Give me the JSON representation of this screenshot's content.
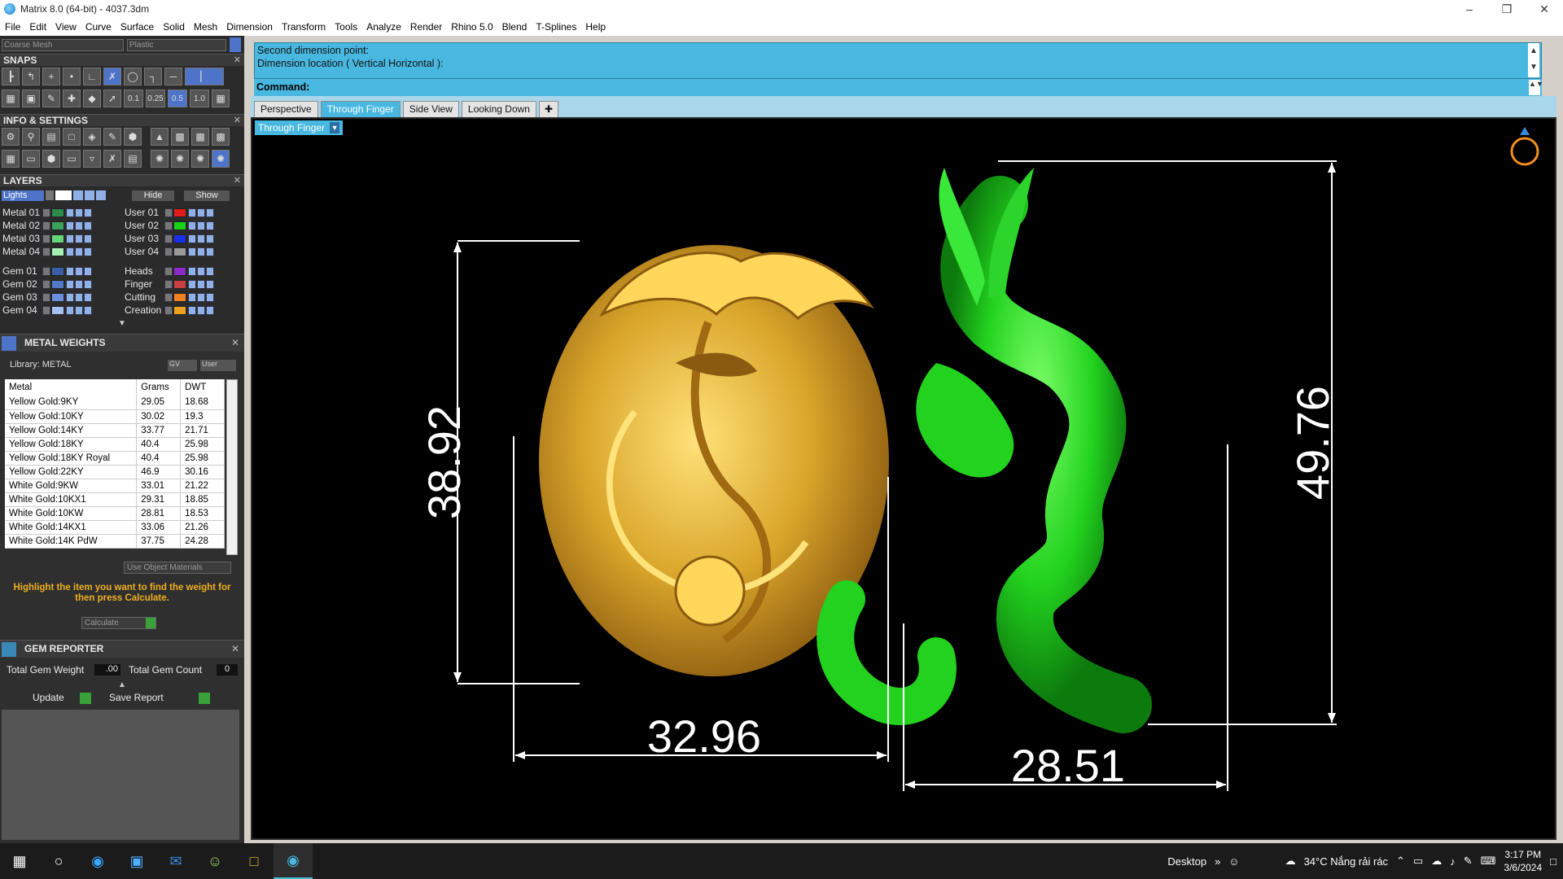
{
  "window": {
    "title": "Matrix 8.0 (64-bit) - 4037.3dm"
  },
  "menu": [
    "File",
    "Edit",
    "View",
    "Curve",
    "Surface",
    "Solid",
    "Mesh",
    "Dimension",
    "Transform",
    "Tools",
    "Analyze",
    "Render",
    "Rhino 5.0",
    "Blend",
    "T-Splines",
    "Help"
  ],
  "mesh_combo": "Coarse Mesh",
  "material_combo": "Plastic",
  "sections": {
    "snaps": "SNAPS",
    "info": "INFO & SETTINGS",
    "layers": "LAYERS",
    "metal_weights": "METAL WEIGHTS",
    "gem_reporter": "GEM REPORTER"
  },
  "snaps": {
    "values": [
      "0.1",
      "0.25",
      "0.5",
      "1.0"
    ]
  },
  "layers": {
    "lights": "Lights",
    "hide": "Hide",
    "show": "Show",
    "left": [
      {
        "name": "Metal 01",
        "color": "#2e8a4a"
      },
      {
        "name": "Metal 02",
        "color": "#3aa25a"
      },
      {
        "name": "Metal 03",
        "color": "#66d477"
      },
      {
        "name": "Metal 04",
        "color": "#a6f0b3"
      },
      {
        "name": "Gem 01",
        "color": "#3a5fa8"
      },
      {
        "name": "Gem 02",
        "color": "#4f78c8"
      },
      {
        "name": "Gem 03",
        "color": "#6b90de"
      },
      {
        "name": "Gem 04",
        "color": "#a4c0f0"
      }
    ],
    "right": [
      {
        "name": "User 01",
        "color": "#e01c1c"
      },
      {
        "name": "User 02",
        "color": "#18d418"
      },
      {
        "name": "User 03",
        "color": "#1830e8"
      },
      {
        "name": "User 04",
        "color": "#9a9a9a"
      },
      {
        "name": "Heads",
        "color": "#8a2ac8"
      },
      {
        "name": "Finger",
        "color": "#c84040"
      },
      {
        "name": "Cutting",
        "color": "#f08020"
      },
      {
        "name": "Creation",
        "color": "#f0a020"
      }
    ]
  },
  "metal_weights": {
    "library": "Library: METAL",
    "gv": "GV",
    "user": "User",
    "headers": [
      "Metal",
      "Grams",
      "DWT"
    ],
    "rows": [
      [
        "Yellow Gold:9KY",
        "29.05",
        "18.68"
      ],
      [
        "Yellow Gold:10KY",
        "30.02",
        "19.3"
      ],
      [
        "Yellow Gold:14KY",
        "33.77",
        "21.71"
      ],
      [
        "Yellow Gold:18KY",
        "40.4",
        "25.98"
      ],
      [
        "Yellow Gold:18KY Royal",
        "40.4",
        "25.98"
      ],
      [
        "Yellow Gold:22KY",
        "46.9",
        "30.16"
      ],
      [
        "White Gold:9KW",
        "33.01",
        "21.22"
      ],
      [
        "White Gold:10KX1",
        "29.31",
        "18.85"
      ],
      [
        "White Gold:10KW",
        "28.81",
        "18.53"
      ],
      [
        "White Gold:14KX1",
        "33.06",
        "21.26"
      ],
      [
        "White Gold:14K PdW",
        "37.75",
        "24.28"
      ]
    ],
    "use_object_materials": "Use Object Materials",
    "hint": "Highlight the item you want to find the weight for then press Calculate.",
    "calculate": "Calculate"
  },
  "gem_reporter": {
    "total_weight_label": "Total Gem Weight",
    "total_weight_value": ".00",
    "total_count_label": "Total Gem Count",
    "total_count_value": "0",
    "update": "Update",
    "save_report": "Save Report"
  },
  "command": {
    "line1": "Second dimension point:",
    "line2": "Dimension location ( Vertical  Horizontal ):",
    "label": "Command:"
  },
  "tabs": [
    "Perspective",
    "Through Finger",
    "Side View",
    "Looking Down"
  ],
  "active_tab": "Through Finger",
  "viewport_label": "Through Finger",
  "dimensions": {
    "gold_height": "38.92",
    "gold_width": "32.96",
    "green_height": "49.76",
    "green_width": "28.51"
  },
  "colors": {
    "gold": "#e0b030",
    "green": "#20d420",
    "accent": "#49b8e0"
  },
  "taskbar": {
    "desktop": "Desktop",
    "weather": "34°C  Nắng rải rác",
    "time": "3:17 PM",
    "date": "3/6/2024"
  }
}
